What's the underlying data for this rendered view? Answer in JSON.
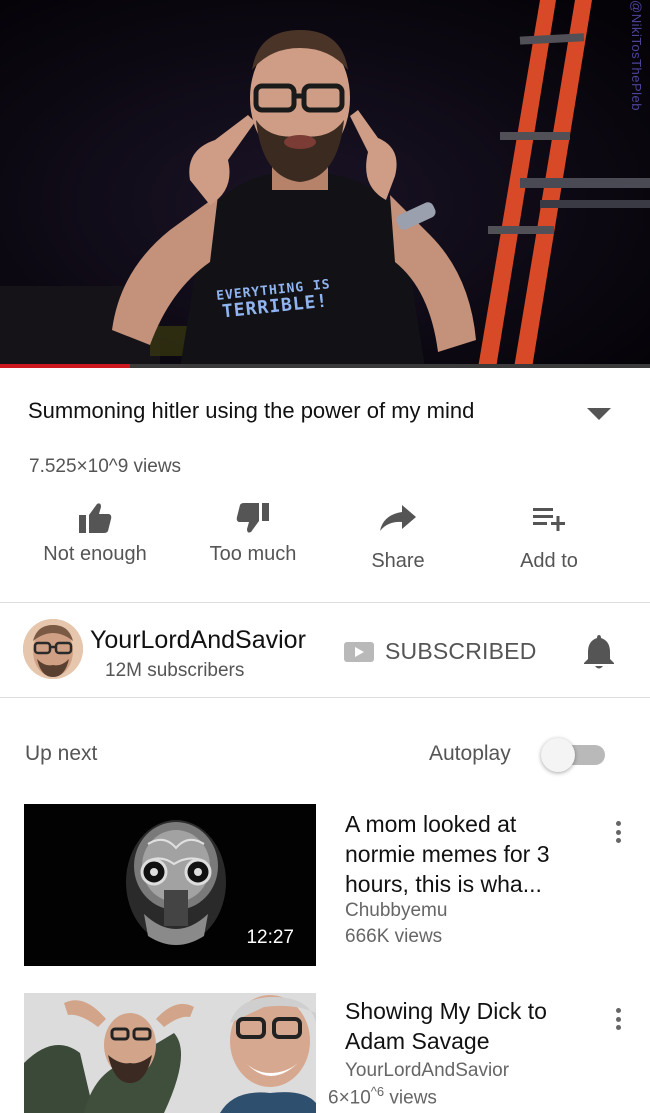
{
  "player": {
    "watermark": "@NikiTosThePleb",
    "shirt_line1": "EVERYTHING IS",
    "shirt_line2": "TERRIBLE!",
    "progress": 0.2,
    "accent_color": "#cc181e"
  },
  "video": {
    "title": "Summoning hitler using the power of my mind",
    "views": "7.525×10^9 views"
  },
  "actions": {
    "like": {
      "label": "Not enough",
      "icon": "thumbs-up-icon"
    },
    "dislike": {
      "label": "Too much",
      "icon": "thumbs-down-icon"
    },
    "share": {
      "label": "Share",
      "icon": "share-arrow-icon"
    },
    "add": {
      "label": "Add to",
      "icon": "playlist-add-icon"
    }
  },
  "channel": {
    "name": "YourLordAndSavior",
    "subscribers": "12M subscribers",
    "subscribe_label": "SUBSCRIBED"
  },
  "up_next": {
    "label": "Up next",
    "autoplay_label": "Autoplay",
    "autoplay_on": false
  },
  "recommendations": [
    {
      "title": "A mom looked at normie memes for 3 hours, this is wha...",
      "channel": "Chubbyemu",
      "views": "666K views",
      "duration": "12:27"
    },
    {
      "title": "Showing My Dick to Adam Savage",
      "channel": "YourLordAndSavior",
      "views_base": "6×10",
      "views_exp": "^6",
      "views_suffix": " views"
    }
  ]
}
